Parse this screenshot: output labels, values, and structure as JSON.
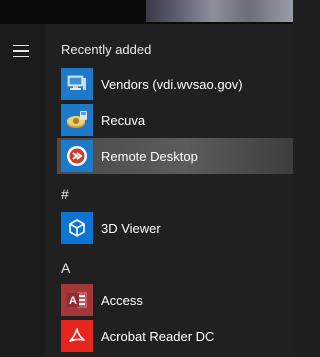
{
  "start_menu": {
    "section_title": "Recently added",
    "recent": [
      {
        "label": "Vendors (vdi.wvsao.gov)",
        "icon": "remote-app-computer-icon",
        "tile_color": "#1f79c9"
      },
      {
        "label": "Recuva",
        "icon": "recuva-hard-drive-icon",
        "tile_color": "#1f79c9"
      },
      {
        "label": "Remote Desktop",
        "icon": "remote-desktop-icon",
        "tile_color": "#1f79c9"
      }
    ],
    "group_hash": "#",
    "hash_items": [
      {
        "label": "3D Viewer",
        "icon": "cube-icon",
        "tile_color": "#0e74d3"
      }
    ],
    "group_a": "A",
    "a_items": [
      {
        "label": "Access",
        "icon": "access-icon",
        "tile_color": "#a4373a",
        "badge": "A"
      },
      {
        "label": "Acrobat Reader DC",
        "icon": "acrobat-reader-icon",
        "tile_color": "#e6251e"
      }
    ]
  }
}
